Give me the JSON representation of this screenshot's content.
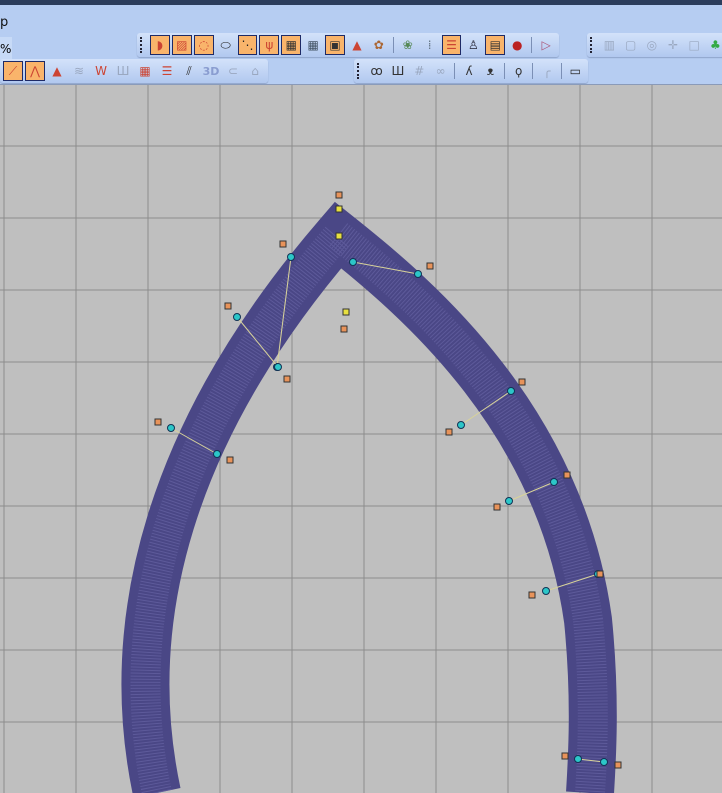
{
  "menu": {
    "partial_label": "p",
    "zoom_suffix": "%"
  },
  "toolbar_top": {
    "buttons": [
      {
        "icon": "satin-fill-icon",
        "active": true
      },
      {
        "icon": "tatami-fill-icon",
        "active": true
      },
      {
        "icon": "outline-fill-icon",
        "active": true
      },
      {
        "icon": "dashed-outline-icon",
        "active": false
      },
      {
        "icon": "stitch-points-icon",
        "active": true
      },
      {
        "icon": "cactus-icon",
        "active": true
      },
      {
        "icon": "grid-icon",
        "active": true
      },
      {
        "icon": "grid-alt-icon",
        "active": false
      },
      {
        "icon": "image-icon",
        "active": true
      },
      {
        "icon": "shapes-icon",
        "active": false
      },
      {
        "icon": "flower-pot-icon",
        "active": false
      },
      {
        "icon": "plant-icon",
        "active": false
      },
      {
        "icon": "dotted-grid-icon",
        "active": false
      },
      {
        "icon": "color-list-icon",
        "active": true
      },
      {
        "icon": "people-icon",
        "active": false
      },
      {
        "icon": "properties-icon",
        "active": true
      },
      {
        "icon": "thread-icon",
        "active": false
      },
      {
        "icon": "run-icon",
        "active": false
      }
    ]
  },
  "toolbar_right": {
    "buttons": [
      {
        "icon": "align-icon"
      },
      {
        "icon": "frame-icon"
      },
      {
        "icon": "center-icon"
      },
      {
        "icon": "move-icon"
      },
      {
        "icon": "square-icon"
      },
      {
        "icon": "tree-icon"
      }
    ]
  },
  "toolbar_second": {
    "label_3d": "3D",
    "buttons": [
      {
        "icon": "fan-icon",
        "active": true
      },
      {
        "icon": "triangle-fill-icon",
        "active": true
      },
      {
        "icon": "triangle-stripe-icon",
        "active": false
      },
      {
        "icon": "wave-stripe-icon",
        "active": false
      },
      {
        "icon": "zigzag-icon",
        "active": false
      },
      {
        "icon": "columns-icon",
        "active": false
      },
      {
        "icon": "pattern-icon",
        "active": false
      },
      {
        "icon": "lines-icon",
        "active": false
      },
      {
        "icon": "hatch-icon",
        "active": false
      }
    ]
  },
  "toolbar_third": {
    "buttons": [
      {
        "icon": "loops-icon"
      },
      {
        "icon": "meander-icon"
      },
      {
        "icon": "hash-icon"
      },
      {
        "icon": "chain-icon"
      },
      {
        "icon": "curl-icon"
      },
      {
        "icon": "double-curl-icon"
      },
      {
        "icon": "knot-icon"
      },
      {
        "icon": "arc-icon"
      },
      {
        "icon": "monitor-icon"
      }
    ]
  },
  "colors": {
    "stitch": "#4a4786",
    "canvas": "#bfbfbf",
    "grid": "#8c8c8c",
    "toolbar": "#b6cdf2",
    "active": "#f9b46b"
  }
}
